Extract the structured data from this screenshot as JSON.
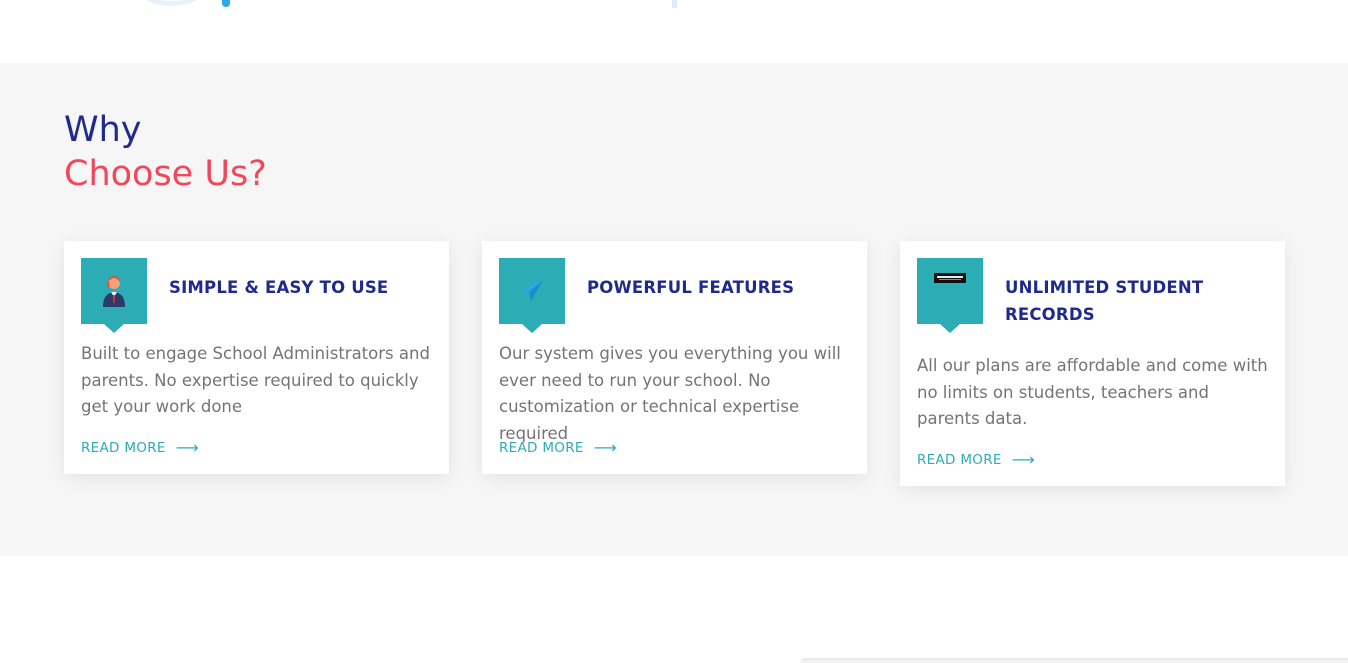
{
  "heading": {
    "line1": "Why",
    "line2": "Choose Us?"
  },
  "cards": [
    {
      "title": "SIMPLE & EASY TO USE",
      "text": "Built to engage School Administrators and parents. No expertise required to quickly get your work done",
      "link": "READ MORE",
      "icon": "support-agent-icon"
    },
    {
      "title": "POWERFUL FEATURES",
      "text": "Our system gives you everything you will ever need to run your school. No customization or technical expertise required",
      "link": "READ MORE",
      "icon": "paper-plane-icon"
    },
    {
      "title": "UNLIMITED STUDENT RECORDS",
      "text": "All our plans are affordable and come with no limits on students, teachers and parents data.",
      "link": "READ MORE",
      "icon": "records-icon"
    }
  ],
  "colors": {
    "navy": "#1f2a8c",
    "coral": "#f2475a",
    "teal": "#2cadb5",
    "body_text": "#747474",
    "section_bg": "#f6f6f6"
  }
}
